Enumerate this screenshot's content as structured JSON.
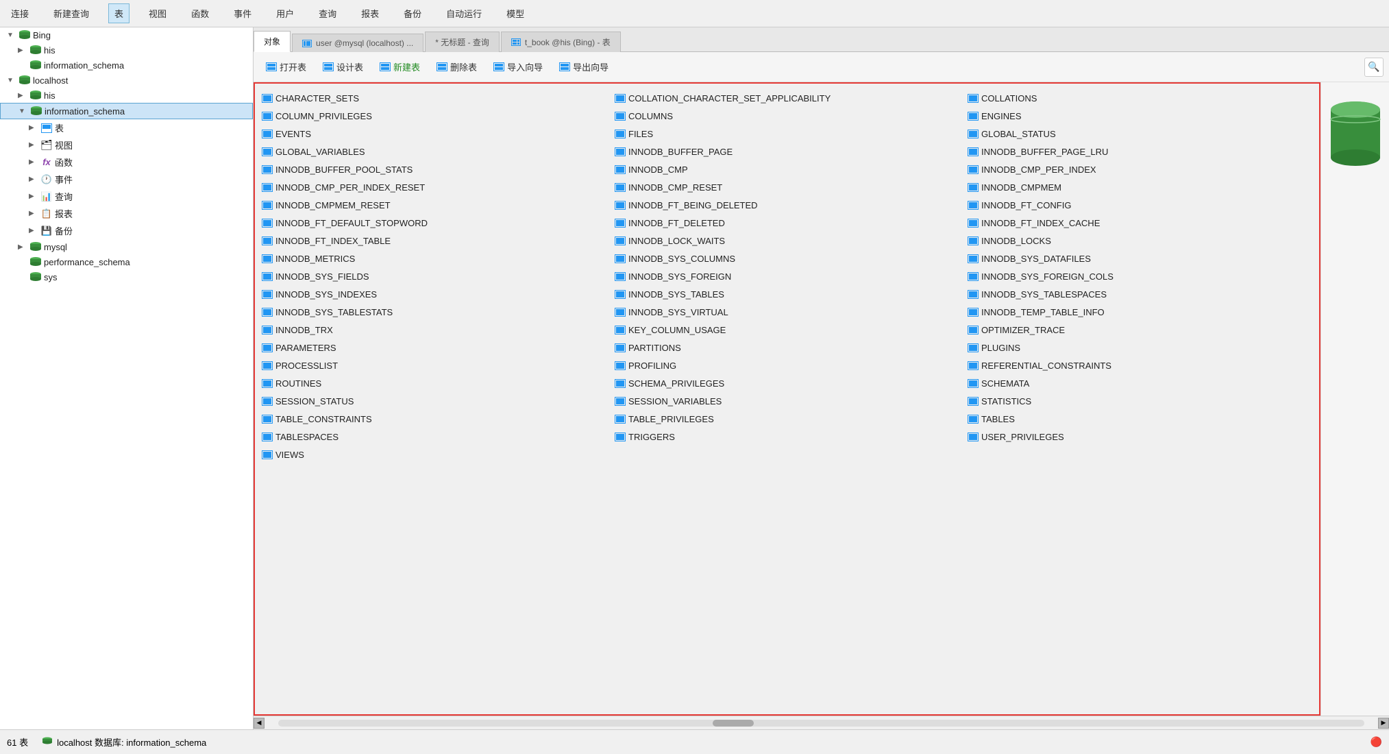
{
  "menubar": {
    "items": [
      "连接",
      "新建查询",
      "表",
      "视图",
      "函数",
      "事件",
      "用户",
      "查询",
      "报表",
      "备份",
      "自动运行",
      "模型"
    ]
  },
  "tabs": [
    {
      "id": "objects",
      "label": "对象",
      "active": false,
      "icon": true
    },
    {
      "id": "user",
      "label": "user @mysql (localhost) ...",
      "active": false,
      "icon": true
    },
    {
      "id": "untitled",
      "label": "* 无标题 - 查询",
      "active": false,
      "icon": false
    },
    {
      "id": "t_book",
      "label": "t_book @his (Bing) - 表",
      "active": true,
      "icon": true
    }
  ],
  "toolbar": {
    "buttons": [
      "打开表",
      "设计表",
      "新建表",
      "删除表",
      "导入向导",
      "导出向导"
    ]
  },
  "sidebar": {
    "connections": [
      {
        "name": "Bing",
        "expanded": true,
        "children": [
          {
            "name": "his",
            "expanded": false,
            "type": "db"
          },
          {
            "name": "information_schema",
            "expanded": false,
            "type": "db"
          }
        ]
      },
      {
        "name": "localhost",
        "expanded": true,
        "children": [
          {
            "name": "his",
            "expanded": false,
            "type": "db"
          },
          {
            "name": "information_schema",
            "expanded": true,
            "type": "db",
            "selected": true,
            "children": [
              {
                "name": "表",
                "type": "table_group"
              },
              {
                "name": "视图",
                "type": "view_group"
              },
              {
                "name": "函数",
                "type": "func_group"
              },
              {
                "name": "事件",
                "type": "event_group"
              },
              {
                "name": "查询",
                "type": "query_group"
              },
              {
                "name": "报表",
                "type": "report_group"
              },
              {
                "name": "备份",
                "type": "backup_group"
              }
            ]
          },
          {
            "name": "mysql",
            "expanded": false,
            "type": "db"
          },
          {
            "name": "performance_schema",
            "expanded": false,
            "type": "db"
          },
          {
            "name": "sys",
            "expanded": false,
            "type": "db"
          }
        ]
      }
    ]
  },
  "tables": [
    "CHARACTER_SETS",
    "COLLATION_CHARACTER_SET_APPLICABILITY",
    "COLLATIONS",
    "COLUMN_PRIVILEGES",
    "COLUMNS",
    "ENGINES",
    "EVENTS",
    "FILES",
    "GLOBAL_STATUS",
    "GLOBAL_VARIABLES",
    "INNODB_BUFFER_PAGE",
    "INNODB_BUFFER_PAGE_LRU",
    "INNODB_BUFFER_POOL_STATS",
    "INNODB_CMP",
    "INNODB_CMP_PER_INDEX",
    "INNODB_CMP_PER_INDEX_RESET",
    "INNODB_CMP_RESET",
    "INNODB_CMPMEM",
    "INNODB_CMPMEM_RESET",
    "INNODB_FT_BEING_DELETED",
    "INNODB_FT_CONFIG",
    "INNODB_FT_DEFAULT_STOPWORD",
    "INNODB_FT_DELETED",
    "INNODB_FT_INDEX_CACHE",
    "INNODB_FT_INDEX_TABLE",
    "INNODB_LOCK_WAITS",
    "INNODB_LOCKS",
    "INNODB_METRICS",
    "INNODB_SYS_COLUMNS",
    "INNODB_SYS_DATAFILES",
    "INNODB_SYS_FIELDS",
    "INNODB_SYS_FOREIGN",
    "INNODB_SYS_FOREIGN_COLS",
    "INNODB_SYS_INDEXES",
    "INNODB_SYS_TABLES",
    "INNODB_SYS_TABLESPACES",
    "INNODB_SYS_TABLESTATS",
    "INNODB_SYS_VIRTUAL",
    "INNODB_TEMP_TABLE_INFO",
    "INNODB_TRX",
    "KEY_COLUMN_USAGE",
    "OPTIMIZER_TRACE",
    "PARAMETERS",
    "PARTITIONS",
    "PLUGINS",
    "PROCESSLIST",
    "PROFILING",
    "REFERENTIAL_CONSTRAINTS",
    "ROUTINES",
    "SCHEMA_PRIVILEGES",
    "SCHEMATA",
    "SESSION_STATUS",
    "SESSION_VARIABLES",
    "STATISTICS",
    "TABLE_CONSTRAINTS",
    "TABLE_PRIVILEGES",
    "TABLES",
    "TABLESPACES",
    "TRIGGERS",
    "USER_PRIVILEGES",
    "VIEWS"
  ],
  "status": {
    "count": "61 表",
    "connection": "localhost  数据库: information_schema"
  }
}
